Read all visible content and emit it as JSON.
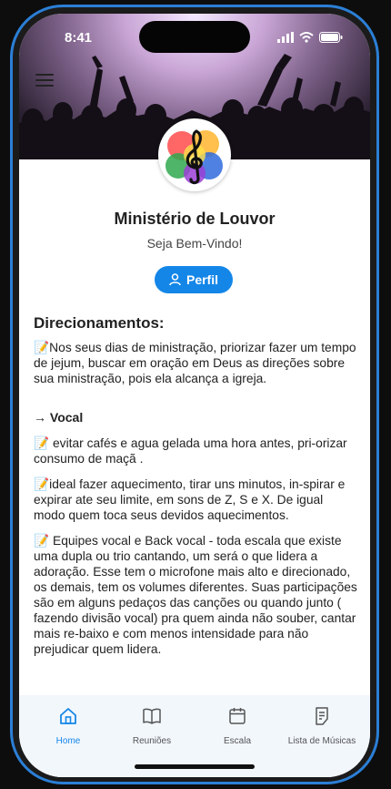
{
  "status_bar": {
    "time": "8:41"
  },
  "header": {
    "menu_icon": "hamburger-menu-icon",
    "logo_icon": "treble-clef-icon",
    "title": "Ministério de Louvor",
    "subtitle": "Seja Bem-Vindo!",
    "profile_button": {
      "label": "Perfil",
      "icon": "person-icon"
    }
  },
  "content": {
    "heading": "Direcionamentos:",
    "intro": "📝Nos seus dias de ministração, priorizar fazer um  tempo de jejum, buscar em oração em Deus as direções sobre sua ministração, pois ela alcança a igreja.",
    "vocal_heading": "→ Vocal",
    "vocal_items": [
      "📝 evitar cafés e agua gelada uma hora antes, pri-orizar consumo de maçã .",
      "📝ideal fazer aquecimento, tirar uns minutos, in-spirar e expirar ate seu limite, em sons de Z, S e X.  De igual modo quem toca seus devidos aquecimentos.",
      "📝 Equipes vocal e Back vocal - toda escala que existe uma dupla ou trio cantando, um será o que lidera a adoração. Esse tem o microfone mais alto e direcionado, os demais, tem os volumes diferentes. Suas participações são em alguns pedaços das canções ou quando junto ( fazendo divisão vocal)  pra quem ainda não souber, cantar mais re-baixo e com menos intensidade para não prejudicar quem lidera."
    ]
  },
  "tabs": [
    {
      "label": "Home",
      "icon": "home-icon",
      "active": true
    },
    {
      "label": "Reuniões",
      "icon": "book-icon",
      "active": false
    },
    {
      "label": "Escala",
      "icon": "calendar-icon",
      "active": false
    },
    {
      "label": "Lista de Músicas",
      "icon": "list-document-icon",
      "active": false
    }
  ],
  "colors": {
    "accent": "#1486e8",
    "phone_frame": "#2b7fd6"
  }
}
